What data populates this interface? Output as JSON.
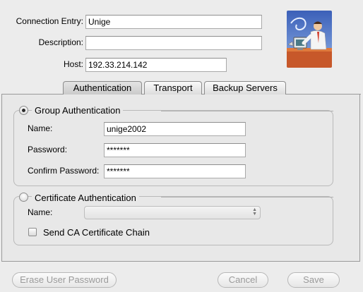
{
  "connection": {
    "entry_label": "Connection Entry:",
    "entry_value": "Unige",
    "description_label": "Description:",
    "description_value": "",
    "host_label": "Host:",
    "host_value": "192.33.214.142"
  },
  "tabs": [
    {
      "label": "Authentication",
      "selected": true
    },
    {
      "label": "Transport",
      "selected": false
    },
    {
      "label": "Backup Servers",
      "selected": false
    }
  ],
  "group_auth": {
    "title": "Group Authentication",
    "selected": true,
    "name_label": "Name:",
    "name_value": "unige2002",
    "password_label": "Password:",
    "password_value": "*******",
    "confirm_label": "Confirm Password:",
    "confirm_value": "*******"
  },
  "cert_auth": {
    "title": "Certificate Authentication",
    "selected": false,
    "name_label": "Name:",
    "name_value": "",
    "send_chain_label": "Send CA Certificate Chain",
    "send_chain_checked": false
  },
  "buttons": {
    "erase": "Erase User Password",
    "cancel": "Cancel",
    "save": "Save"
  },
  "icons": {
    "logo": "vpn-user-at-computer-illustration",
    "select_arrows": "up-down-arrows-icon"
  }
}
